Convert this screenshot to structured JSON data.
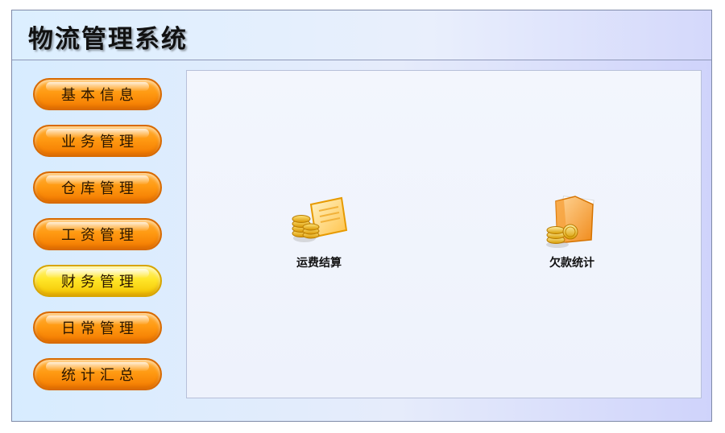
{
  "app": {
    "title": "物流管理系统"
  },
  "sidebar": {
    "items": [
      {
        "label": "基本信息",
        "active": false
      },
      {
        "label": "业务管理",
        "active": false
      },
      {
        "label": "仓库管理",
        "active": false
      },
      {
        "label": "工资管理",
        "active": false
      },
      {
        "label": "财务管理",
        "active": true
      },
      {
        "label": "日常管理",
        "active": false
      },
      {
        "label": "统计汇总",
        "active": false
      }
    ]
  },
  "main": {
    "tiles": [
      {
        "label": "运费结算",
        "icon": "coins-document-icon"
      },
      {
        "label": "欠款统计",
        "icon": "folder-coins-icon"
      }
    ]
  },
  "colors": {
    "nav_button": "#ff9a12",
    "nav_button_active": "#ffe629",
    "panel_background": "#f1f4fc"
  }
}
